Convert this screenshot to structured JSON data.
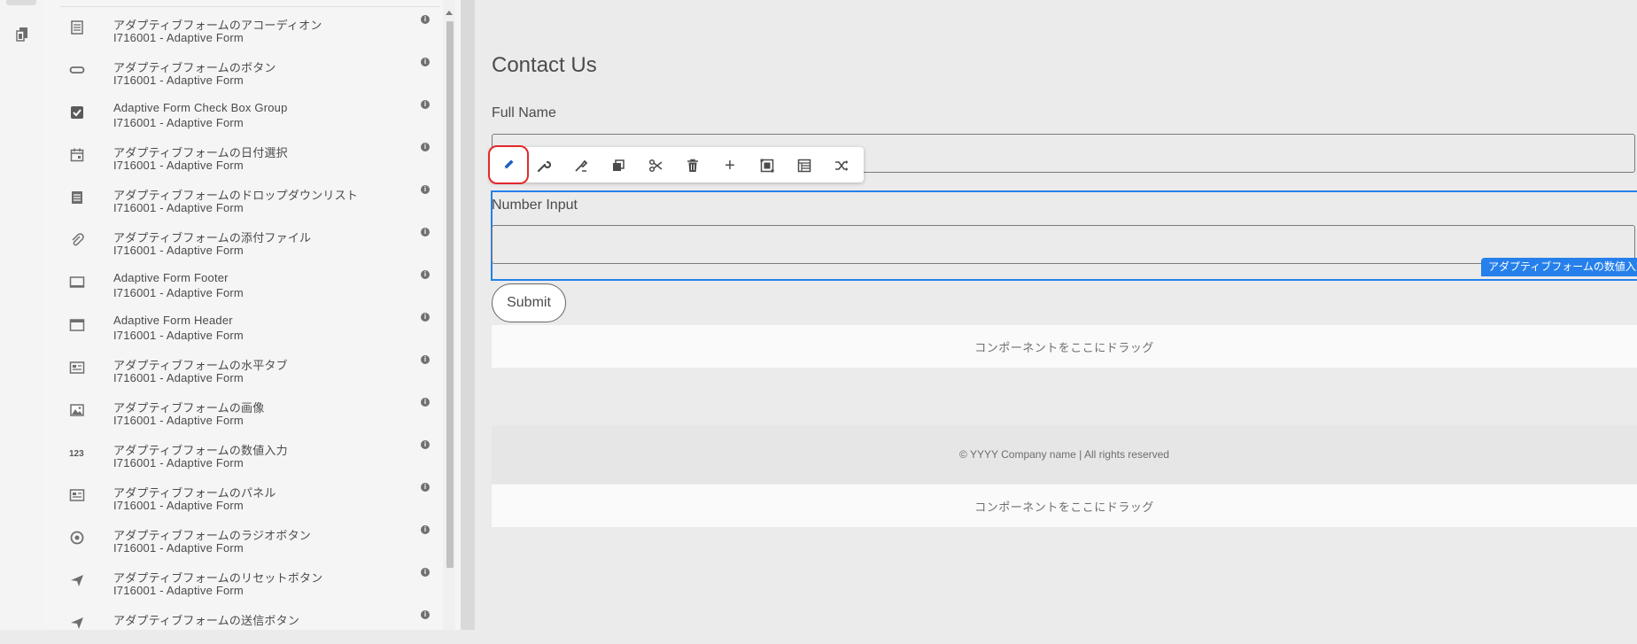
{
  "rail": {
    "icon": "content-tree-icon"
  },
  "components": [
    {
      "icon": "accordion-icon",
      "name": "アダプティブフォームのアコーディオン",
      "group": "I716001 - Adaptive Form"
    },
    {
      "icon": "button-icon",
      "name": "アダプティブフォームのボタン",
      "group": "I716001 - Adaptive Form"
    },
    {
      "icon": "checkbox-icon",
      "name": "Adaptive Form Check Box Group",
      "group": "I716001 - Adaptive Form"
    },
    {
      "icon": "calendar-icon",
      "name": "アダプティブフォームの日付選択",
      "group": "I716001 - Adaptive Form"
    },
    {
      "icon": "dropdown-icon",
      "name": "アダプティブフォームのドロップダウンリスト",
      "group": "I716001 - Adaptive Form"
    },
    {
      "icon": "attachment-icon",
      "name": "アダプティブフォームの添付ファイル",
      "group": "I716001 - Adaptive Form"
    },
    {
      "icon": "footer-icon",
      "name": "Adaptive Form Footer",
      "group": "I716001 - Adaptive Form"
    },
    {
      "icon": "header-icon",
      "name": "Adaptive Form Header",
      "group": "I716001 - Adaptive Form"
    },
    {
      "icon": "tabs-icon",
      "name": "アダプティブフォームの水平タブ",
      "group": "I716001 - Adaptive Form"
    },
    {
      "icon": "image-icon",
      "name": "アダプティブフォームの画像",
      "group": "I716001 - Adaptive Form"
    },
    {
      "icon": "number-icon",
      "name": "アダプティブフォームの数値入力",
      "group": "I716001 - Adaptive Form"
    },
    {
      "icon": "panel-icon",
      "name": "アダプティブフォームのパネル",
      "group": "I716001 - Adaptive Form"
    },
    {
      "icon": "radio-icon",
      "name": "アダプティブフォームのラジオボタン",
      "group": "I716001 - Adaptive Form"
    },
    {
      "icon": "send-icon",
      "name": "アダプティブフォームのリセットボタン",
      "group": "I716001 - Adaptive Form"
    },
    {
      "icon": "send-icon",
      "name": "アダプティブフォームの送信ボタン",
      "group": ""
    }
  ],
  "info_glyph": "i",
  "number_glyph": "123",
  "form": {
    "title": "Contact Us",
    "full_name_label": "Full Name",
    "number_label": "Number Input",
    "selected_tag": "アダプティブフォームの数値入力",
    "submit": "Submit",
    "drop_zone_1": "コンポーネントをここにドラッグ",
    "footer_text": "© YYYY Company name | All rights reserved",
    "drop_zone_2": "コンポーネントをここにドラッグ"
  },
  "toolbar": {
    "buttons": [
      "edit-icon",
      "configure-icon",
      "style-icon",
      "copy-icon",
      "cut-icon",
      "delete-icon",
      "insert-icon",
      "group-icon",
      "layout-icon",
      "convert-icon"
    ],
    "plus": "+"
  },
  "colors": {
    "accent": "#2680eb",
    "highlight": "#e3292d"
  }
}
